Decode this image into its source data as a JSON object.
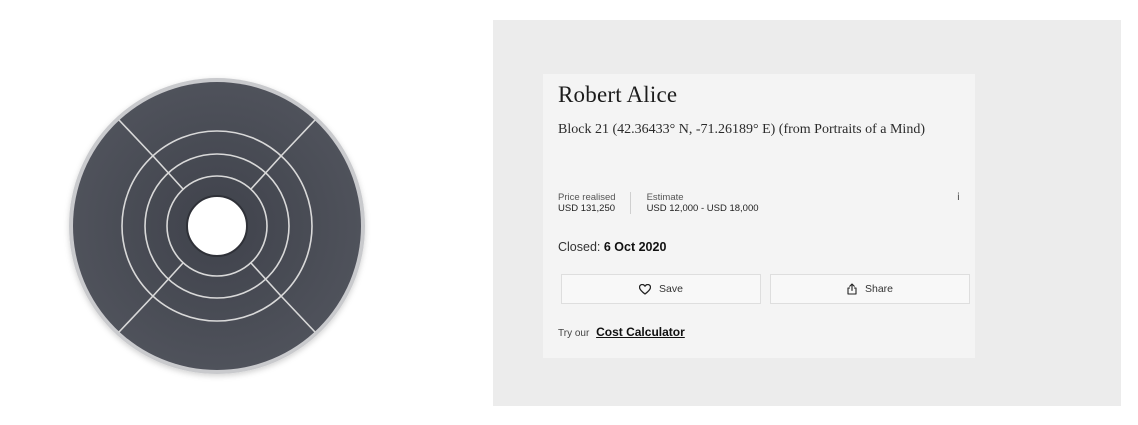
{
  "artwork": {
    "icon": "circular-disc-artwork"
  },
  "lot": {
    "artist": "Robert Alice",
    "title": "Block 21 (42.36433° N, -71.26189° E) (from Portraits of a Mind)",
    "price_realised_label": "Price realised",
    "price_realised_value": "USD 131,250",
    "estimate_label": "Estimate",
    "estimate_value": "USD 12,000 - USD 18,000",
    "info_icon": "i",
    "closed_label": "Closed:",
    "closed_date": "6 Oct 2020"
  },
  "actions": {
    "save_label": "Save",
    "save_icon": "heart-icon",
    "share_label": "Share",
    "share_icon": "share-icon"
  },
  "footer": {
    "try_label": "Try our",
    "cost_calculator_label": "Cost Calculator"
  },
  "colors": {
    "panel_bg": "#ececec",
    "card_bg": "#f4f4f4",
    "disc": "#4a4d56"
  }
}
